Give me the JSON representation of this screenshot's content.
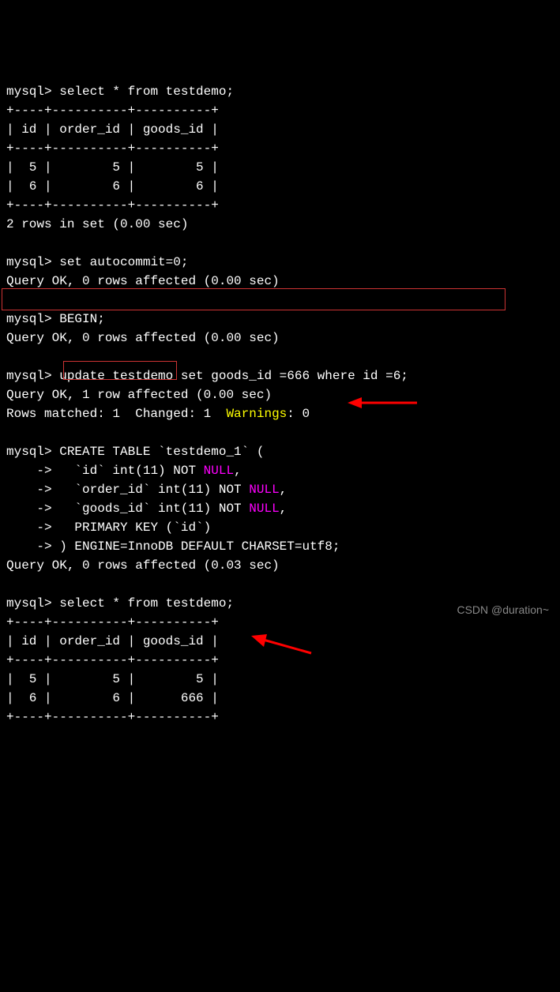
{
  "prompt": "mysql>",
  "cont_prompt": "    ->",
  "queries": {
    "select1": "select * from testdemo;",
    "set_autocommit": "set autocommit=0;",
    "begin": "BEGIN;",
    "update": "update testdemo set goods_id =666 where id =6;",
    "select2": "select * from testdemo;"
  },
  "create_table": {
    "line1_a": "CREATE TABLE",
    "line1_b": " `testdemo_1` (",
    "line2_a": "  `id` int(11) NOT ",
    "line2_null": "NULL",
    "line2_b": ",",
    "line3_a": "  `order_id` int(11) NOT ",
    "line3_null": "NULL",
    "line3_b": ",",
    "line4_a": "  `goods_id` int(11) NOT ",
    "line4_null": "NULL",
    "line4_b": ",",
    "line5": "  PRIMARY KEY (`id`)",
    "line6": ") ENGINE=InnoDB DEFAULT CHARSET=utf8;"
  },
  "table1": {
    "border": "+----+----------+----------+",
    "header": "| id | order_id | goods_id |",
    "row1": "|  5 |        5 |        5 |",
    "row2": "|  6 |        6 |        6 |"
  },
  "table2": {
    "border": "+----+----------+----------+",
    "header": "| id | order_id | goods_id |",
    "row1": "|  5 |        5 |        5 |",
    "row2": "|  6 |        6 |      666 |"
  },
  "results": {
    "two_rows": "2 rows in set (0.00 sec)",
    "ok_0_rows": "Query OK, 0 rows affected (0.00 sec)",
    "ok_1_row": "Query OK, 1 row affected (0.00 sec)",
    "rows_matched_a": "Rows matched: 1  Changed: 1  ",
    "rows_matched_warn": "Warnings",
    "rows_matched_b": ": 0",
    "ok_0_rows_003": "Query OK, 0 rows affected (0.03 sec)"
  },
  "watermark": "CSDN @duration~"
}
